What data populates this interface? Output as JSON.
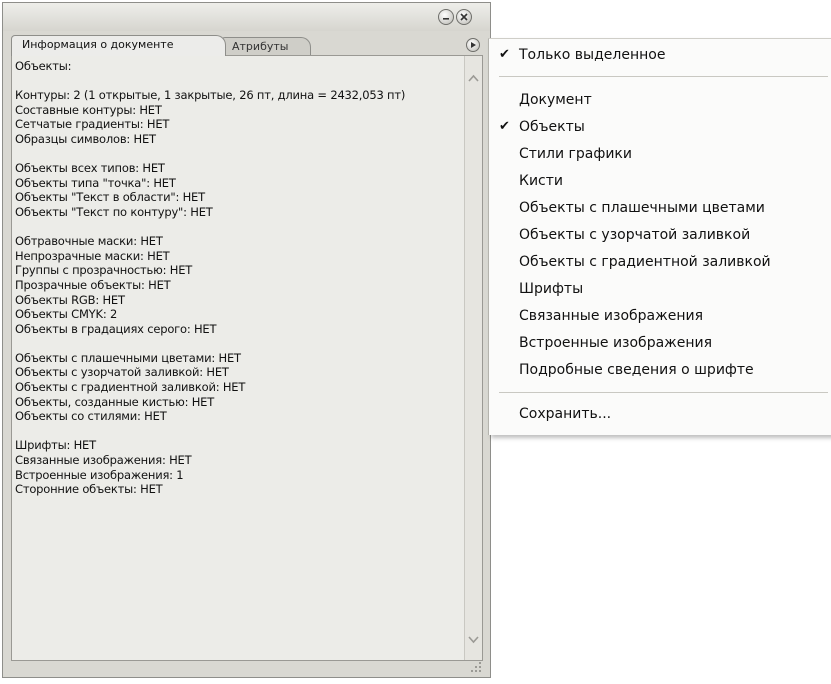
{
  "panel": {
    "tabs": {
      "active": "Информация о документе",
      "inactive": "Атрибуты"
    },
    "info_text": "Объекты:\n\nКонтуры: 2 (1 открытые, 1 закрытые, 26 пт, длина = 2432,053 пт)\nСоставные контуры: НЕТ\nСетчатые градиенты: НЕТ\nОбразцы символов: НЕТ\n\nОбъекты всех типов: НЕТ\nОбъекты типа \"точка\": НЕТ\nОбъекты \"Текст в области\": НЕТ\nОбъекты \"Текст по контуру\": НЕТ\n\nОбтравочные маски: НЕТ\nНепрозрачные маски: НЕТ\nГруппы с прозрачностью: НЕТ\nПрозрачные объекты: НЕТ\nОбъекты RGB: НЕТ\nОбъекты CMYK: 2\nОбъекты в градациях серого: НЕТ\n\nОбъекты с плашечными цветами: НЕТ\nОбъекты с узорчатой заливкой: НЕТ\nОбъекты с градиентной заливкой: НЕТ\nОбъекты, созданные кистью: НЕТ\nОбъекты со стилями: НЕТ\n\nШрифты: НЕТ\nСвязанные изображения: НЕТ\nВстроенные изображения: 1\nСторонние объекты: НЕТ"
  },
  "menu": {
    "selected_only": {
      "label": "Только выделенное",
      "checked": true
    },
    "items": [
      {
        "label": "Документ",
        "checked": false
      },
      {
        "label": "Объекты",
        "checked": true
      },
      {
        "label": "Стили графики",
        "checked": false
      },
      {
        "label": "Кисти",
        "checked": false
      },
      {
        "label": "Объекты с плашечными цветами",
        "checked": false
      },
      {
        "label": "Объекты с узорчатой заливкой",
        "checked": false
      },
      {
        "label": "Объекты с градиентной заливкой",
        "checked": false
      },
      {
        "label": "Шрифты",
        "checked": false
      },
      {
        "label": "Связанные изображения",
        "checked": false
      },
      {
        "label": "Встроенные изображения",
        "checked": false
      },
      {
        "label": "Подробные сведения о шрифте",
        "checked": false
      }
    ],
    "save": {
      "label": "Сохранить..."
    },
    "check_glyph": "✔"
  },
  "icons": {
    "minimize": "minimize-icon",
    "close": "close-icon",
    "panel_menu": "panel-menu-arrow-icon",
    "scroll_up": "scroll-up-arrow-icon",
    "scroll_down": "scroll-down-arrow-icon",
    "resize_grip": "resize-grip-icon"
  }
}
